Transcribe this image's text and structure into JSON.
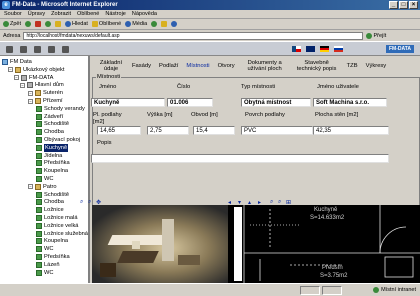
{
  "window": {
    "title": "FM-Data - Microsoft Internet Explorer"
  },
  "menu": [
    "Soubor",
    "Úpravy",
    "Zobrazit",
    "Oblíbené",
    "Nástroje",
    "Nápověda"
  ],
  "toolbar": {
    "back": "Zpět",
    "search": "Hledat",
    "favorites": "Oblíbené",
    "media": "Média"
  },
  "address": {
    "label": "Adresa",
    "url": "http://localhost/fmdata/nexuws/default.asp",
    "go": "Přejít"
  },
  "brand": "FM-DATA",
  "tree": {
    "items": [
      {
        "label": "FM Data",
        "icon": "root"
      },
      {
        "label": "Ukázkový objekt",
        "icon": "folder"
      },
      {
        "label": "FM-DATA",
        "icon": "build"
      },
      {
        "label": "Hlavní dům",
        "icon": "build"
      },
      {
        "label": "Suterén",
        "icon": "folder"
      },
      {
        "label": "Přízemí",
        "icon": "folder"
      },
      {
        "label": "Schody verandy",
        "icon": "room"
      },
      {
        "label": "Zádveří",
        "icon": "room"
      },
      {
        "label": "Schodiště",
        "icon": "room"
      },
      {
        "label": "Chodba",
        "icon": "room"
      },
      {
        "label": "Obývací pokoj",
        "icon": "room"
      },
      {
        "label": "Kuchyně",
        "icon": "room"
      },
      {
        "label": "Jídelna",
        "icon": "room"
      },
      {
        "label": "Předsíňka",
        "icon": "room"
      },
      {
        "label": "Koupelna",
        "icon": "room"
      },
      {
        "label": "WC",
        "icon": "room"
      },
      {
        "label": "Patro",
        "icon": "folder"
      },
      {
        "label": "Schodiště",
        "icon": "room"
      },
      {
        "label": "Chodba",
        "icon": "room"
      },
      {
        "label": "Ložnice",
        "icon": "room"
      },
      {
        "label": "Ložnice malá",
        "icon": "room"
      },
      {
        "label": "Ložnice velká",
        "icon": "room"
      },
      {
        "label": "Ložnice služebná",
        "icon": "room"
      },
      {
        "label": "Koupelna",
        "icon": "room"
      },
      {
        "label": "WC",
        "icon": "room"
      },
      {
        "label": "Předsíňka",
        "icon": "room"
      },
      {
        "label": "Lázeň",
        "icon": "room"
      },
      {
        "label": "WC",
        "icon": "room"
      }
    ]
  },
  "tabs": [
    "Základní údaje",
    "Fasády",
    "Podlaží",
    "Místnosti",
    "Otvory",
    "Dokumenty a užívání ploch",
    "Stavebně technický popis",
    "TZB",
    "Výkresy"
  ],
  "form": {
    "legend": "Místnosti",
    "labels": {
      "name": "Jméno",
      "number": "Číslo",
      "type": "Typ místnosti",
      "user": "Jméno uživatele",
      "floor_area": "Pl. podlahy [m2]",
      "height": "Výška [m]",
      "perimeter": "Obvod [m]",
      "floor_surface": "Povrch podlahy",
      "wall_area": "Plocha stěn [m2]",
      "description": "Popis"
    },
    "values": {
      "name": "Kuchyně",
      "number": "01.006",
      "type": "Obytná místnost",
      "user": "Soft Machina s.r.o.",
      "floor_area": "14,65",
      "height": "2,75",
      "perimeter": "15,4",
      "floor_surface": "PVC",
      "wall_area": "42,35",
      "description": ""
    }
  },
  "viewer": {
    "label_top": "Kuchyně",
    "area_top": "S=14.633m2",
    "label_bottom": "Předsíň",
    "area_bottom": "S=3.75m2"
  },
  "status": {
    "zone": "Místní intranet"
  }
}
